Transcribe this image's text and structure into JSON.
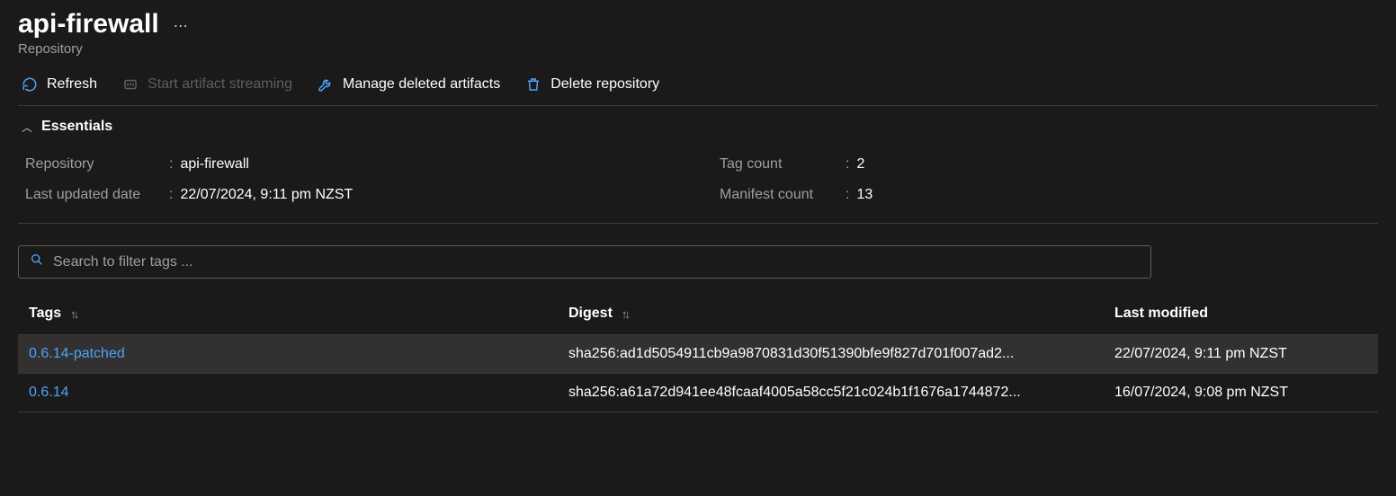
{
  "header": {
    "title": "api-firewall",
    "subtitle": "Repository"
  },
  "toolbar": {
    "refresh": "Refresh",
    "start_streaming": "Start artifact streaming",
    "manage_deleted": "Manage deleted artifacts",
    "delete_repo": "Delete repository"
  },
  "essentials": {
    "heading": "Essentials",
    "repository_label": "Repository",
    "repository_value": "api-firewall",
    "last_updated_label": "Last updated date",
    "last_updated_value": "22/07/2024, 9:11 pm NZST",
    "tag_count_label": "Tag count",
    "tag_count_value": "2",
    "manifest_count_label": "Manifest count",
    "manifest_count_value": "13"
  },
  "search": {
    "placeholder": "Search to filter tags ..."
  },
  "table": {
    "columns": {
      "tags": "Tags",
      "digest": "Digest",
      "last_modified": "Last modified"
    },
    "rows": [
      {
        "tag": "0.6.14-patched",
        "digest": "sha256:ad1d5054911cb9a9870831d30f51390bfe9f827d701f007ad2...",
        "last_modified": "22/07/2024, 9:11 pm NZST"
      },
      {
        "tag": "0.6.14",
        "digest": "sha256:a61a72d941ee48fcaaf4005a58cc5f21c024b1f1676a1744872...",
        "last_modified": "16/07/2024, 9:08 pm NZST"
      }
    ]
  }
}
